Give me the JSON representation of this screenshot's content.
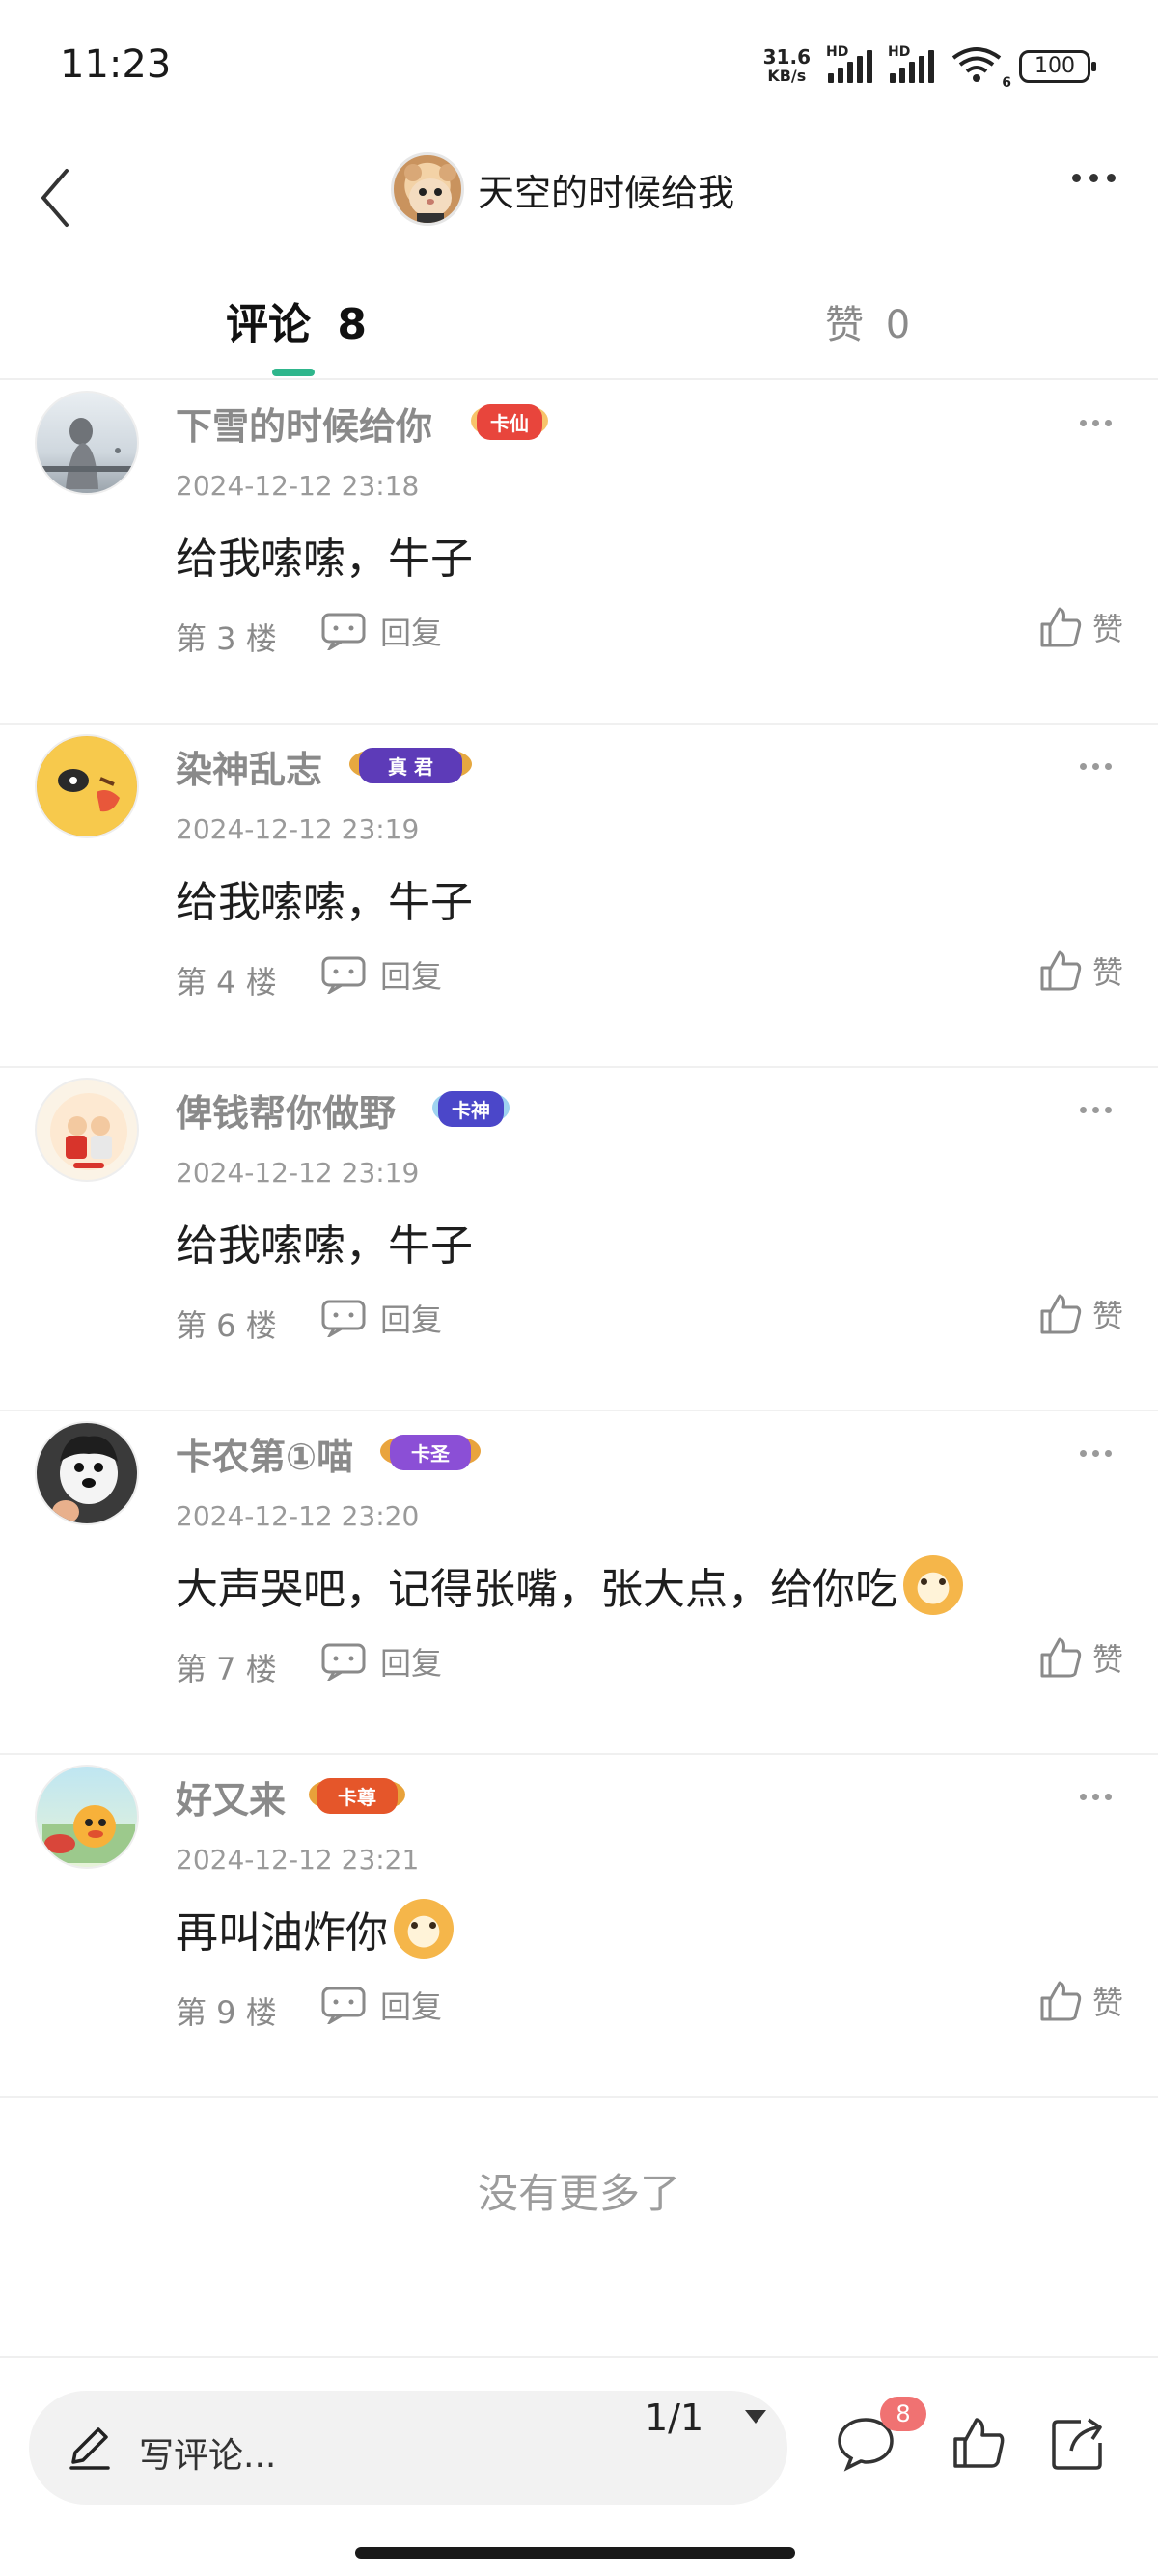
{
  "status_bar": {
    "time": "11:23",
    "net_speed_value": "31.6",
    "net_speed_unit": "KB/s",
    "signal_1_label": "HD",
    "signal_2_label": "HD",
    "wifi_label": "6",
    "battery": "100"
  },
  "header": {
    "title": "天空的时候给我",
    "back_icon": "chevron-left-icon",
    "more_icon": "more-horizontal-icon"
  },
  "tabs": {
    "comments_label": "评论",
    "comments_count": "8",
    "likes_label": "赞",
    "likes_count": "0"
  },
  "comments": [
    {
      "name": "下雪的时候给你",
      "badge": "卡仙",
      "time": "2024-12-12 23:18",
      "text": "给我嗦嗦，牛子",
      "emoji": false,
      "floor": "第 3 楼",
      "reply": "回复",
      "like": "赞"
    },
    {
      "name": "染神乱志",
      "badge": "真 君",
      "time": "2024-12-12 23:19",
      "text": "给我嗦嗦，牛子",
      "emoji": false,
      "floor": "第 4 楼",
      "reply": "回复",
      "like": "赞"
    },
    {
      "name": "俾钱帮你做野",
      "badge": "卡神",
      "time": "2024-12-12 23:19",
      "text": "给我嗦嗦，牛子",
      "emoji": false,
      "floor": "第 6 楼",
      "reply": "回复",
      "like": "赞"
    },
    {
      "name": "卡农第①喵",
      "badge": "卡圣",
      "time": "2024-12-12 23:20",
      "text": "大声哭吧，记得张嘴，张大点，给你吃",
      "emoji": true,
      "floor": "第 7 楼",
      "reply": "回复",
      "like": "赞"
    },
    {
      "name": "好又来",
      "badge": "卡尊",
      "time": "2024-12-12 23:21",
      "text": "再叫油炸你",
      "emoji": true,
      "floor": "第 9 楼",
      "reply": "回复",
      "like": "赞"
    }
  ],
  "footer_text": "没有更多了",
  "bottom_bar": {
    "input_placeholder": "写评论...",
    "pager": "1/1",
    "comment_count": "8"
  },
  "colors": {
    "accent": "#2fb68c",
    "badge_red": "#f07272"
  }
}
